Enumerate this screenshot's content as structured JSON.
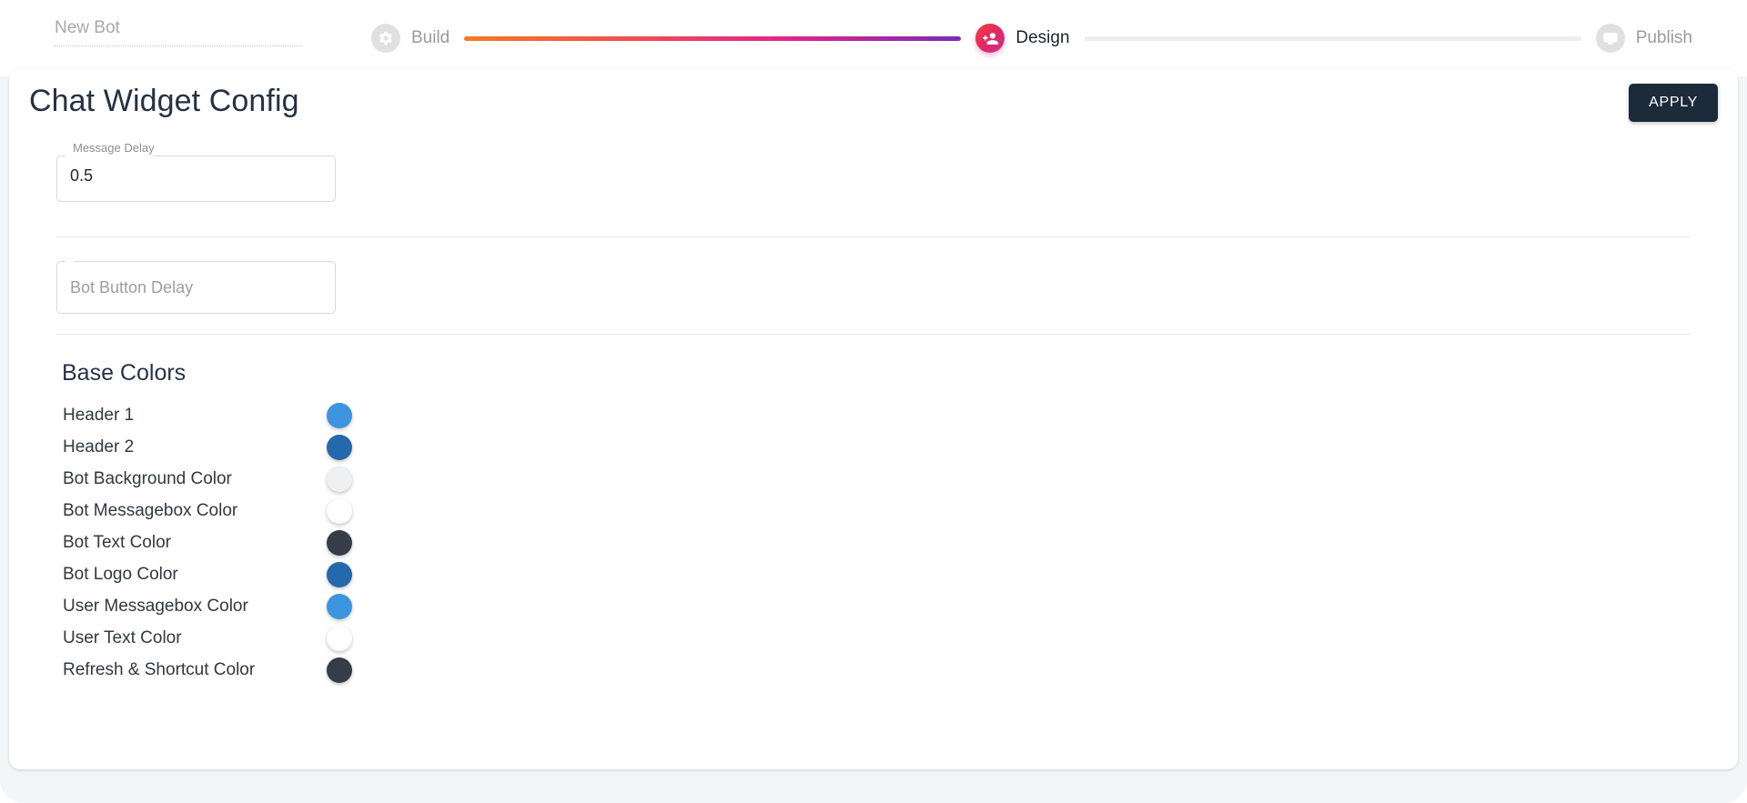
{
  "top_bar": {
    "bot_name_placeholder": "New Bot",
    "bot_name_value": ""
  },
  "stepper": {
    "steps": [
      {
        "label": "Build",
        "icon": "gear-icon",
        "state": "inactive"
      },
      {
        "label": "Design",
        "icon": "group-add-icon",
        "state": "active"
      },
      {
        "label": "Publish",
        "icon": "monitor-icon",
        "state": "inactive"
      }
    ],
    "connectors": [
      {
        "style": "gradient",
        "colors": [
          "#f47b20",
          "#ef4d55",
          "#e0258d",
          "#7b2bb5"
        ]
      },
      {
        "style": "plain",
        "colors": [
          "#eceef3"
        ]
      }
    ],
    "active_circle_gradient": [
      "#f2453d",
      "#e5285e",
      "#c4308f"
    ],
    "inactive_circle_color": "#e0e0e0"
  },
  "main": {
    "title": "Chat Widget Config",
    "apply_label": "APPLY",
    "apply_color": "#1c2b3a",
    "fields": [
      {
        "name": "message-delay",
        "label": "Message Delay",
        "value": "0.5",
        "placeholder": "Message Delay",
        "has_float_label": true
      },
      {
        "name": "bot-button-delay",
        "label": "Bot Button Delay",
        "value": "",
        "placeholder": "Bot Button Delay",
        "has_float_label": false
      }
    ],
    "base_colors": {
      "section_title": "Base Colors",
      "items": [
        {
          "label": "Header 1",
          "color": "#3d94e0"
        },
        {
          "label": "Header 2",
          "color": "#2569ad"
        },
        {
          "label": "Bot Background Color",
          "color": "#eef0f2"
        },
        {
          "label": "Bot Messagebox Color",
          "color": "#ffffff"
        },
        {
          "label": "Bot Text Color",
          "color": "#353d49"
        },
        {
          "label": "Bot Logo Color",
          "color": "#2569ad"
        },
        {
          "label": "User Messagebox Color",
          "color": "#3d94e0"
        },
        {
          "label": "User Text Color",
          "color": "#ffffff"
        },
        {
          "label": "Refresh & Shortcut Color",
          "color": "#353d49"
        }
      ]
    }
  }
}
